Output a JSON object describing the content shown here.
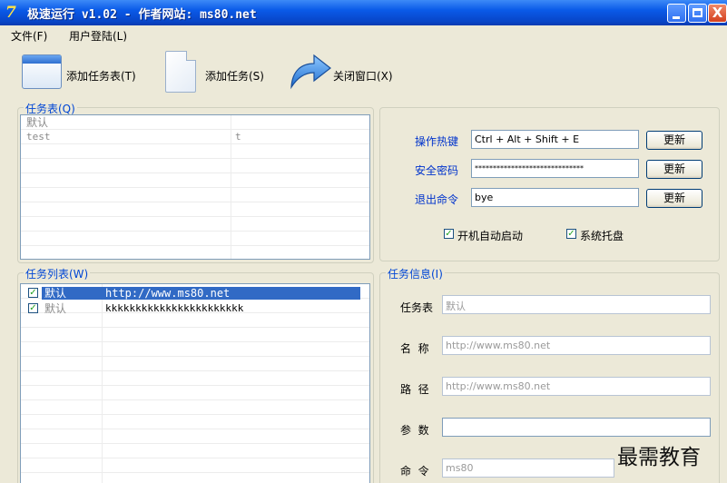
{
  "window": {
    "title": "极速运行 v1.02 - 作者网站: ms80.net",
    "app_icon": "7",
    "controls": {
      "close": "X"
    }
  },
  "menu": [
    {
      "label": "文件(F)"
    },
    {
      "label": "用户登陆(L)"
    }
  ],
  "toolbar": {
    "add_task_table": "添加任务表(T)",
    "add_task": "添加任务(S)",
    "close_window": "关闭窗口(X)"
  },
  "task_tables": {
    "group_title": "任务表(Q)",
    "rows": [
      {
        "name": "默认",
        "key": ""
      },
      {
        "name": "test",
        "key": "t"
      }
    ]
  },
  "settings": {
    "hotkey_label": "操作热键",
    "hotkey_value": "Ctrl + Alt + Shift + E",
    "password_label": "安全密码",
    "password_value": "******************************",
    "exit_label": "退出命令",
    "exit_value": "bye",
    "update_button": "更新",
    "autostart_label": "开机自动启动",
    "autostart_checked": true,
    "tray_label": "系统托盘",
    "tray_checked": true
  },
  "task_list": {
    "group_title": "任务列表(W)",
    "rows": [
      {
        "checked": true,
        "table": "默认",
        "command": "http://www.ms80.net",
        "selected": true
      },
      {
        "checked": true,
        "table": "默认",
        "command": "kkkkkkkkkkkkkkkkkkkkkkk",
        "selected": false
      }
    ]
  },
  "task_info": {
    "group_title": "任务信息(I)",
    "table_label": "任务表",
    "table_value": "默认",
    "name_label": "名  称",
    "name_value": "http://www.ms80.net",
    "path_label": "路  径",
    "path_value": "http://www.ms80.net",
    "params_label": "参  数",
    "params_value": "",
    "command_label": "命  令",
    "command_value": "ms80"
  },
  "watermark": "最需教育",
  "colors": {
    "titlebar": "#0a5ae8",
    "selection": "#316ac5",
    "label_blue": "#0033cc",
    "group_title": "#0046d5"
  }
}
